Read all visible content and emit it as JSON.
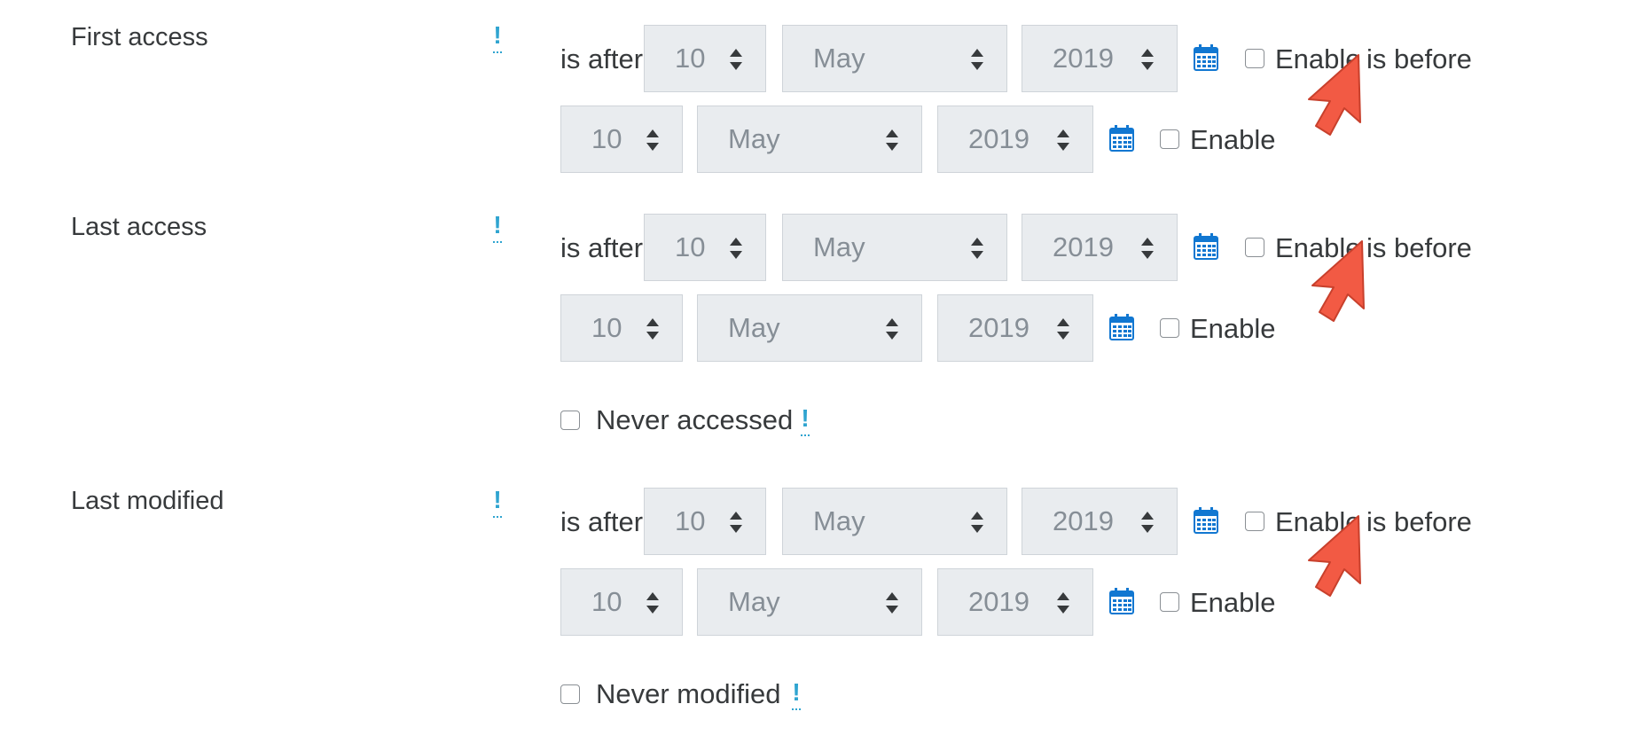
{
  "groups": [
    {
      "label": "First access",
      "condition_label": "is after",
      "after": {
        "day": "10",
        "month": "May",
        "year": "2019",
        "enable_label": "Enable"
      },
      "before_label": "is before",
      "before": {
        "day": "10",
        "month": "May",
        "year": "2019",
        "enable_label": "Enable"
      }
    },
    {
      "label": "Last access",
      "condition_label": "is after",
      "after": {
        "day": "10",
        "month": "May",
        "year": "2019",
        "enable_label": "Enable"
      },
      "before_label": "is before",
      "before": {
        "day": "10",
        "month": "May",
        "year": "2019",
        "enable_label": "Enable"
      },
      "never_label": "Never accessed"
    },
    {
      "label": "Last modified",
      "condition_label": "is after",
      "after": {
        "day": "10",
        "month": "May",
        "year": "2019",
        "enable_label": "Enable"
      },
      "before_label": "is before",
      "before": {
        "day": "10",
        "month": "May",
        "year": "2019",
        "enable_label": "Enable"
      },
      "never_label": "Never modified"
    }
  ],
  "icons": {
    "help": "help-exclamation-icon",
    "calendar": "calendar-icon",
    "pointer": "red-arrow-pointer-icon"
  },
  "colors": {
    "help": "#2fa4d0",
    "calendar": "#1177d1",
    "pointer": "#f25a44",
    "select_bg": "#e9ecef",
    "text": "#373a3c",
    "select_text": "#868e96"
  }
}
